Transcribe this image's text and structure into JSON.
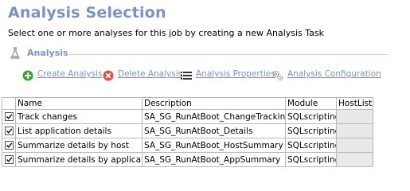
{
  "header": {
    "title": "Analysis Selection",
    "subtitle": "Select one or more analyses for this job by creating a new Analysis Task"
  },
  "section": {
    "label": "Analysis",
    "icon": "flask-icon"
  },
  "toolbar": {
    "create_label": "Create Analysis",
    "delete_label": "Delete Analysis",
    "properties_label": "Analysis Properties",
    "configuration_label": "Analysis Configuration"
  },
  "table": {
    "columns": [
      "",
      "Name",
      "Description",
      "Module",
      "HostLists"
    ],
    "rows": [
      {
        "checked": true,
        "name": "Track changes",
        "description": "SA_SG_RunAtBoot_ChangeTracking",
        "module": "SQLscripting",
        "hostlists": ""
      },
      {
        "checked": true,
        "name": "List application details",
        "description": "SA_SG_RunAtBoot_Details",
        "module": "SQLscripting",
        "hostlists": ""
      },
      {
        "checked": true,
        "name": "Summarize details by host",
        "description": "SA_SG_RunAtBoot_HostSummary",
        "module": "SQLscripting",
        "hostlists": ""
      },
      {
        "checked": true,
        "name": "Summarize details by application",
        "description": "SA_SG_RunAtBoot_AppSummary",
        "module": "SQLscripting",
        "hostlists": ""
      }
    ]
  },
  "colors": {
    "title_blue": "#7a93c6",
    "add_green": "#3aa335",
    "delete_red": "#d9534f"
  }
}
